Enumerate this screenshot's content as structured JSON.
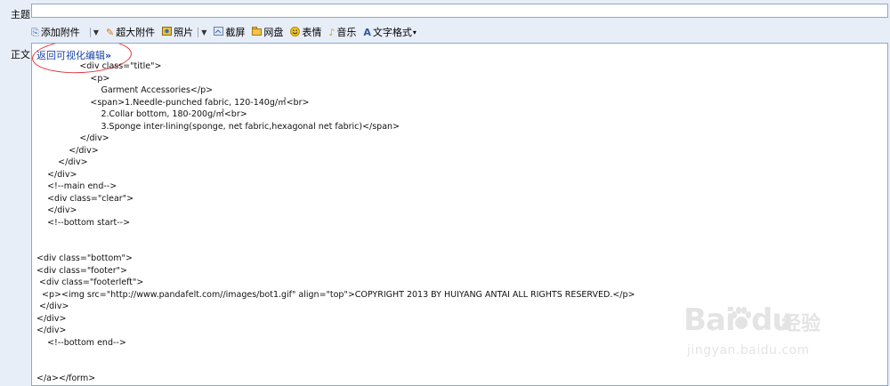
{
  "form": {
    "subject_label": "主题",
    "subject_value": "",
    "body_label": "正文"
  },
  "toolbar": {
    "items": [
      {
        "label": "添加附件",
        "icon": "paperclip-icon"
      },
      {
        "label": "超大附件",
        "icon": "large-attachment-icon"
      },
      {
        "label": "照片",
        "icon": "photo-icon"
      },
      {
        "label": "截屏",
        "icon": "screenshot-icon"
      },
      {
        "label": "网盘",
        "icon": "netdisk-icon"
      },
      {
        "label": "表情",
        "icon": "smiley-icon"
      },
      {
        "label": "音乐",
        "icon": "music-icon"
      },
      {
        "label": "文字格式",
        "icon": "text-format-icon"
      }
    ]
  },
  "editor": {
    "visual_link": "返回可视化编辑",
    "visual_link_arrow": "»",
    "annotation_color": "#e2333b",
    "code_lines": [
      "                <div class=\"title\">",
      "                    <p>",
      "                        Garment Accessories</p>",
      "                    <span>1.Needle-punched fabric, 120-140g/㎡<br>",
      "                        2.Collar bottom, 180-200g/㎡<br>",
      "                        3.Sponge inter-lining(sponge, net fabric,hexagonal net fabric)</span>",
      "                </div>",
      "            </div>",
      "        </div>",
      "    </div>",
      "    <!--main end-->",
      "    <div class=\"clear\">",
      "    </div>",
      "    <!--bottom start-->",
      "",
      "",
      "<div class=\"bottom\">",
      "<div class=\"footer\">",
      " <div class=\"footerleft\">",
      "  <p><img src=\"http://www.pandafelt.com//images/bot1.gif\" align=\"top\">COPYRIGHT 2013 BY HUIYANG ANTAI ALL RIGHTS RESERVED.</p>",
      " </div>",
      "</div>",
      "</div>",
      "    <!--bottom end-->",
      "",
      "",
      "</a></form>"
    ]
  },
  "watermark": {
    "text_left": "Bai",
    "text_right": "du",
    "text_cn": "经验",
    "url": "jingyan.baidu.com"
  }
}
